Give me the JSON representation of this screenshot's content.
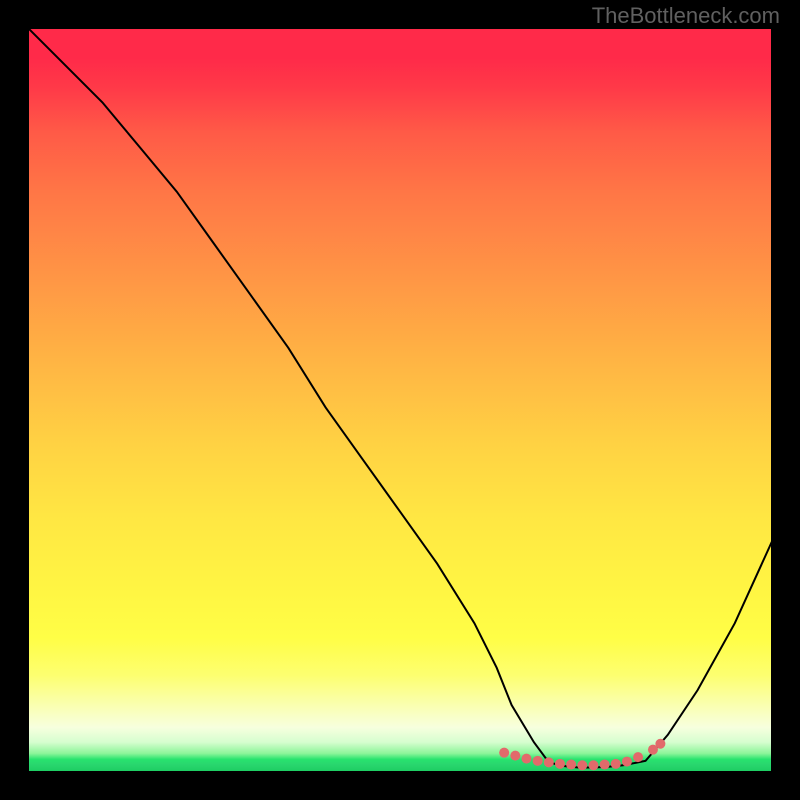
{
  "attribution": "TheBottleneck.com",
  "chart_data": {
    "type": "line",
    "title": "",
    "xlabel": "",
    "ylabel": "",
    "xlim": [
      0,
      100
    ],
    "ylim": [
      0,
      100
    ],
    "x": [
      0,
      5,
      10,
      15,
      20,
      25,
      30,
      35,
      40,
      45,
      50,
      55,
      60,
      63,
      65,
      68,
      70,
      72,
      74,
      76,
      78,
      80,
      83,
      86,
      90,
      95,
      100
    ],
    "values": [
      100,
      95,
      90,
      84,
      78,
      71,
      64,
      57,
      49,
      42,
      35,
      28,
      20,
      14,
      9,
      4,
      1.3,
      0.8,
      0.6,
      0.6,
      0.7,
      0.9,
      1.5,
      5,
      11,
      20,
      31
    ],
    "marker_points": {
      "x": [
        64,
        65.5,
        67,
        68.5,
        70,
        71.5,
        73,
        74.5,
        76,
        77.5,
        79,
        80.5,
        82
      ],
      "y": [
        2.6,
        2.2,
        1.8,
        1.5,
        1.3,
        1.1,
        1.0,
        0.9,
        0.9,
        1.0,
        1.1,
        1.4,
        2.0
      ]
    },
    "marker_points_right": {
      "x": [
        84,
        85
      ],
      "y": [
        3.0,
        3.8
      ]
    },
    "marker_color": "#e26a6b",
    "line_color": "#000000"
  }
}
